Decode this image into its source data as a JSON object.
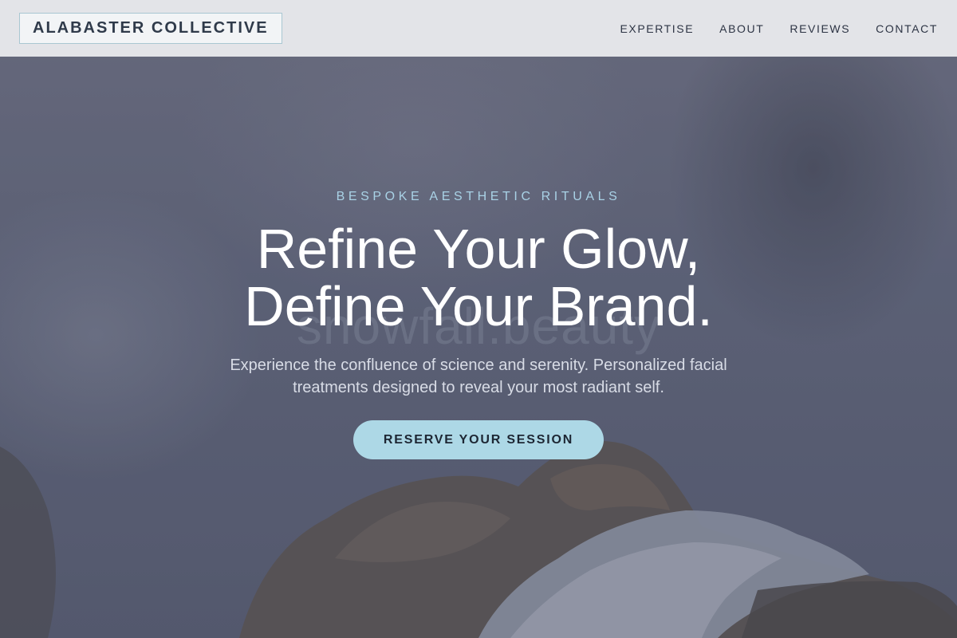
{
  "header": {
    "logo": "ALABASTER COLLECTIVE",
    "nav": [
      {
        "label": "EXPERTISE"
      },
      {
        "label": "ABOUT"
      },
      {
        "label": "REVIEWS"
      },
      {
        "label": "CONTACT"
      }
    ]
  },
  "hero": {
    "eyebrow": "BESPOKE AESTHETIC RITUALS",
    "headline_line1": "Refine Your Glow,",
    "headline_line2": "Define Your Brand.",
    "subtext": "Experience the confluence of science and serenity. Personalized facial treatments designed to reveal your most radiant self.",
    "cta_label": "RESERVE YOUR SESSION",
    "watermark": "snowfall.beauty",
    "background_icon": "face-with-foam-photo"
  },
  "colors": {
    "header_bg": "#e3e4e8",
    "accent": "#add8e6",
    "eyebrow": "#a9d2e6",
    "hero_overlay": "#5e6377"
  }
}
